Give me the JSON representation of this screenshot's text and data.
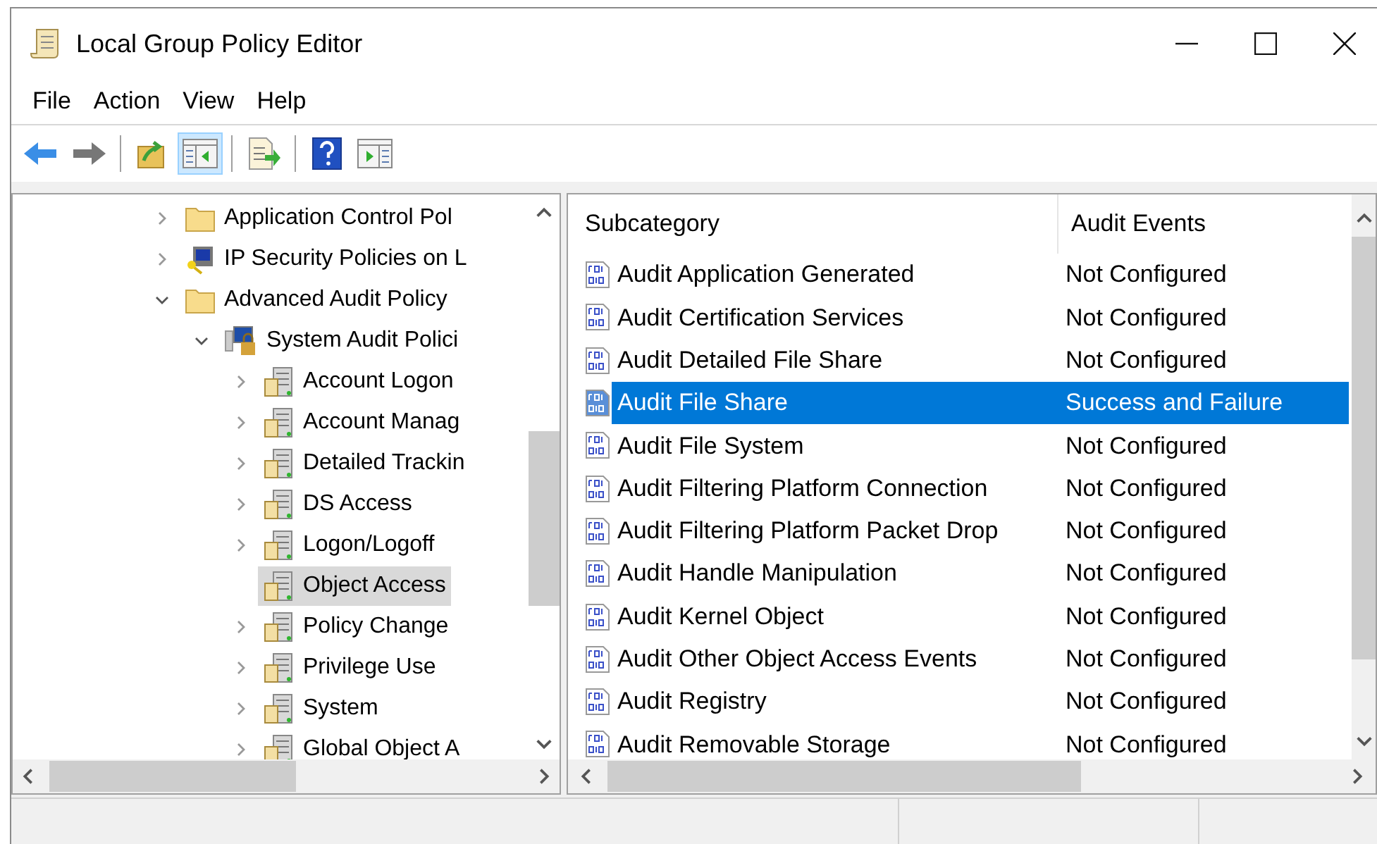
{
  "window": {
    "title": "Local Group Policy Editor"
  },
  "menu": [
    "File",
    "Action",
    "View",
    "Help"
  ],
  "toolbar": [
    {
      "kind": "back",
      "selected": false
    },
    {
      "kind": "forward",
      "selected": false
    },
    {
      "kind": "sep"
    },
    {
      "kind": "up",
      "selected": false
    },
    {
      "kind": "tree",
      "selected": true
    },
    {
      "kind": "sep"
    },
    {
      "kind": "export",
      "selected": false
    },
    {
      "kind": "sep"
    },
    {
      "kind": "help",
      "selected": false
    },
    {
      "kind": "action",
      "selected": false
    }
  ],
  "tree": [
    {
      "label": "Application Control Pol",
      "kind": "folder",
      "expanded": false,
      "selected": false
    },
    {
      "label": "IP Security Policies on L",
      "kind": "ipsec",
      "expanded": false,
      "selected": false
    },
    {
      "label": "Advanced Audit Policy",
      "kind": "folder",
      "expanded": true,
      "selected": false,
      "children": [
        {
          "label": "System Audit Polici",
          "kind": "computer",
          "expanded": true,
          "selected": false,
          "children": [
            {
              "label": "Account Logon",
              "kind": "category",
              "expanded": false,
              "selected": false
            },
            {
              "label": "Account Manag",
              "kind": "category",
              "expanded": false,
              "selected": false
            },
            {
              "label": "Detailed Trackin",
              "kind": "category",
              "expanded": false,
              "selected": false
            },
            {
              "label": "DS Access",
              "kind": "category",
              "expanded": false,
              "selected": false
            },
            {
              "label": "Logon/Logoff",
              "kind": "category",
              "expanded": false,
              "selected": false
            },
            {
              "label": "Object Access",
              "kind": "category",
              "selected": true
            },
            {
              "label": "Policy Change",
              "kind": "category",
              "expanded": false,
              "selected": false
            },
            {
              "label": "Privilege Use",
              "kind": "category",
              "expanded": false,
              "selected": false
            },
            {
              "label": "System",
              "kind": "category",
              "expanded": false,
              "selected": false
            },
            {
              "label": "Global Object A",
              "kind": "category",
              "expanded": false,
              "selected": false
            }
          ]
        }
      ]
    }
  ],
  "table": {
    "columns": [
      "Subcategory",
      "Audit Events"
    ],
    "rows": [
      {
        "subcategory": "Audit Application Generated",
        "audit_events": "Not Configured",
        "selected": false
      },
      {
        "subcategory": "Audit Certification Services",
        "audit_events": "Not Configured",
        "selected": false
      },
      {
        "subcategory": "Audit Detailed File Share",
        "audit_events": "Not Configured",
        "selected": false
      },
      {
        "subcategory": "Audit File Share",
        "audit_events": "Success and Failure",
        "selected": true
      },
      {
        "subcategory": "Audit File System",
        "audit_events": "Not Configured",
        "selected": false
      },
      {
        "subcategory": "Audit Filtering Platform Connection",
        "audit_events": "Not Configured",
        "selected": false
      },
      {
        "subcategory": "Audit Filtering Platform Packet Drop",
        "audit_events": "Not Configured",
        "selected": false
      },
      {
        "subcategory": "Audit Handle Manipulation",
        "audit_events": "Not Configured",
        "selected": false
      },
      {
        "subcategory": "Audit Kernel Object",
        "audit_events": "Not Configured",
        "selected": false
      },
      {
        "subcategory": "Audit Other Object Access Events",
        "audit_events": "Not Configured",
        "selected": false
      },
      {
        "subcategory": "Audit Registry",
        "audit_events": "Not Configured",
        "selected": false
      },
      {
        "subcategory": "Audit Removable Storage",
        "audit_events": "Not Configured",
        "selected": false
      }
    ]
  }
}
